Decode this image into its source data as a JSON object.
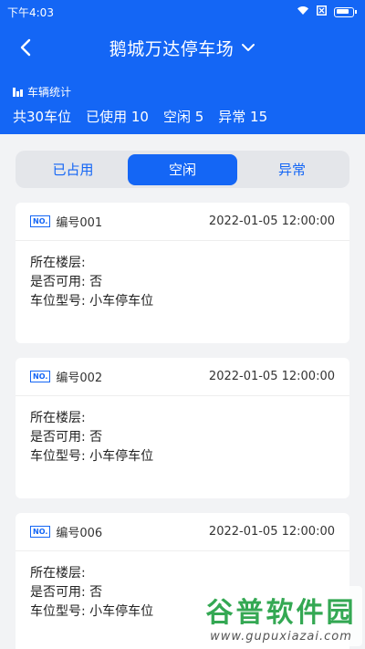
{
  "status_bar": {
    "time": "下午4:03"
  },
  "nav": {
    "title": "鹅城万达停车场"
  },
  "stats": {
    "label": "车辆统计",
    "total": "共30车位",
    "used": "已使用 10",
    "free": "空闲 5",
    "abnormal": "异常 15"
  },
  "tabs": [
    {
      "label": "已占用"
    },
    {
      "label": "空闲"
    },
    {
      "label": "异常"
    }
  ],
  "badge_text": "NO.",
  "cards": [
    {
      "number": "编号001",
      "time": "2022-01-05 12:00:00",
      "floor": "所在楼层:",
      "available": "是否可用: 否",
      "type": "车位型号: 小车停车位"
    },
    {
      "number": "编号002",
      "time": "2022-01-05 12:00:00",
      "floor": "所在楼层:",
      "available": "是否可用: 否",
      "type": "车位型号: 小车停车位"
    },
    {
      "number": "编号006",
      "time": "2022-01-05 12:00:00",
      "floor": "所在楼层:",
      "available": "是否可用: 否",
      "type": "车位型号: 小车停车位"
    }
  ],
  "watermark": {
    "title": "谷普软件园",
    "url": "www.gupuxiazai.com"
  },
  "colors": {
    "primary": "#1466f5",
    "background": "#f2f3f5"
  }
}
